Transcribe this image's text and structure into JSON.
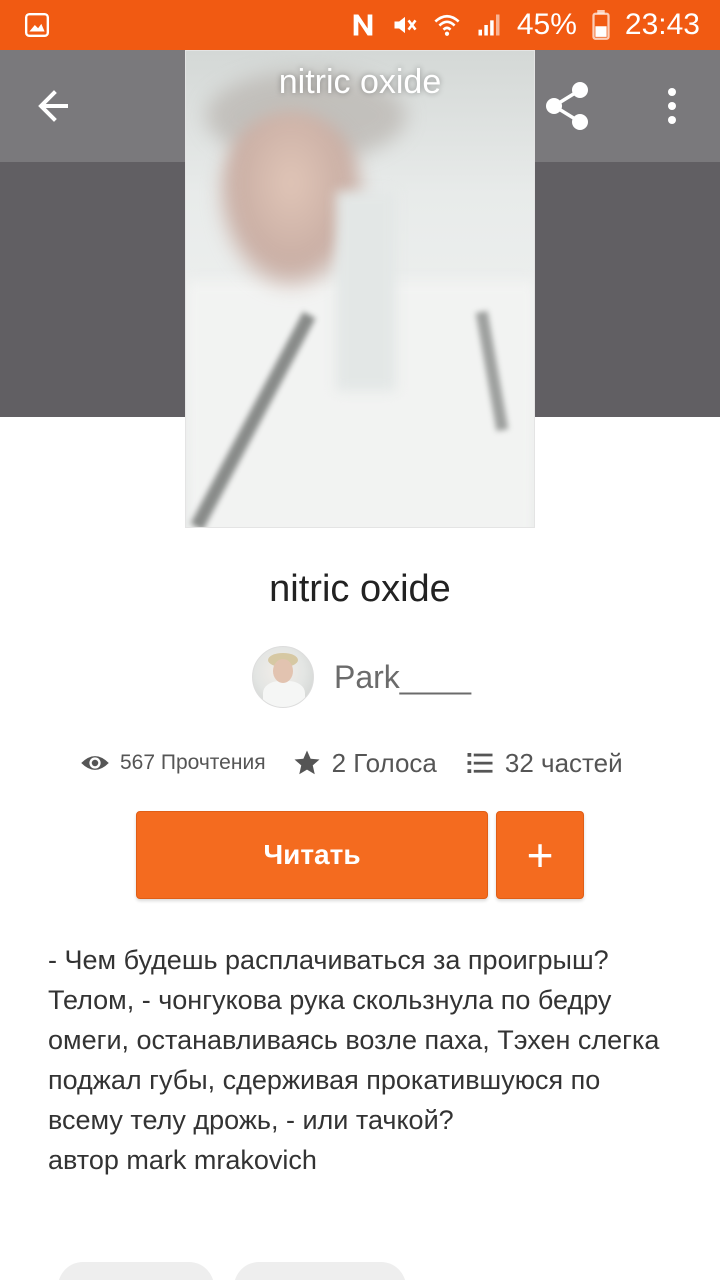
{
  "status_bar": {
    "battery_percent": "45%",
    "time": "23:43",
    "icons": [
      "gallery-icon",
      "nfc-icon",
      "mute-icon",
      "wifi-icon",
      "signal-icon",
      "battery-icon"
    ],
    "background": "#f15a12"
  },
  "header": {
    "icons": [
      "back-arrow-icon",
      "share-icon",
      "more-vert-icon"
    ]
  },
  "cover": {
    "title": "nitric oxide"
  },
  "story": {
    "title": "nitric oxide",
    "author": "Park____"
  },
  "stats": {
    "views": "567 Прочтения",
    "votes": "2 Голоса",
    "parts": "32 частей"
  },
  "actions": {
    "read_label": "Читать",
    "add_label": "+",
    "accent": "#f46b1f"
  },
  "description": "- Чем будешь расплачиваться за проигрыш? Телом, - чонгукова рука скользнула по бедру омеги, останавливаясь возле паха, Тэхен слегка поджал губы, сдерживая прокатившуюся по всему телу дрожь, - или тачкой?\n автор mark mrakovich"
}
